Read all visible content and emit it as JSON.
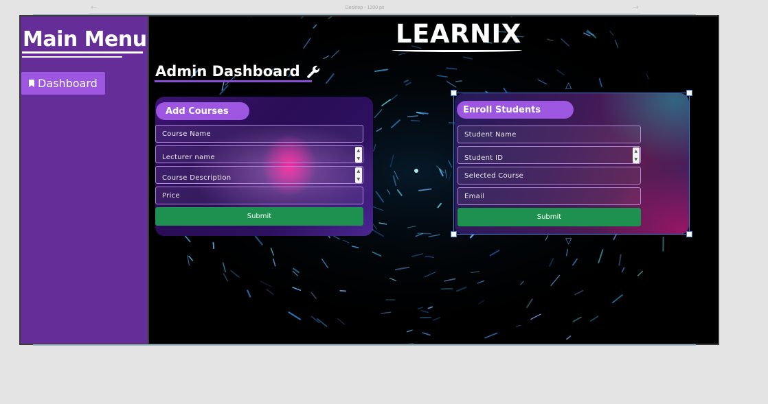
{
  "canvas": {
    "frame_label": "Desktop - 1200 px"
  },
  "sidebar": {
    "title": "Main Menu",
    "items": [
      {
        "label": "Dashboard",
        "icon": "bookmark-icon"
      }
    ]
  },
  "header": {
    "brand": "LEARNIX",
    "page_title": "Admin Dashboard",
    "page_title_icon": "wrench-icon"
  },
  "add_courses": {
    "title": "Add Courses",
    "fields": [
      {
        "placeholder": "Course Name"
      },
      {
        "placeholder": "Lecturer name"
      },
      {
        "placeholder": "Course Description"
      },
      {
        "placeholder": "Price"
      }
    ],
    "submit_label": "Submit"
  },
  "enroll_students": {
    "title": "Enroll Students",
    "fields": [
      {
        "placeholder": "Student Name"
      },
      {
        "placeholder": "Student ID"
      },
      {
        "placeholder": "Selected Course"
      },
      {
        "placeholder": "Email"
      }
    ],
    "submit_label": "Submit"
  },
  "colors": {
    "sidebar": "#652d98",
    "accent_purple": "#9c56df",
    "submit_green": "#1e9151",
    "selection_blue": "#3d7bd9"
  }
}
